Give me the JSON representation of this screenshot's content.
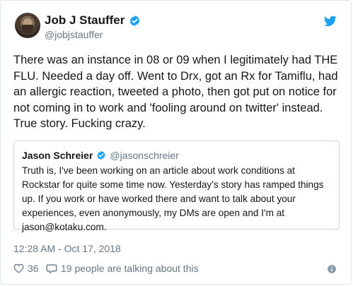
{
  "author": {
    "display_name": "Job J Stauffer",
    "handle": "@jobjstauffer",
    "verified_icon": "verified-badge-icon"
  },
  "tweet": {
    "text": "There was an instance in 08 or 09 when I legitimately had THE FLU. Needed a day off. Went to Drx, got an Rx for Tamiflu, had an allergic reaction, tweeted a photo, then got put on notice for not coming in to work and 'fooling around on twitter' instead. True story. Fucking crazy.",
    "timestamp": "12:28 AM - Oct 17, 2018"
  },
  "quoted_tweet": {
    "display_name": "Jason Schreier",
    "handle": "@jasonschreier",
    "text": "Truth is, I've been working on an article about work conditions at Rockstar for quite some time now. Yesterday's story has ramped things up. If you work or have worked there and want to talk about your experiences, even anonymously, my DMs are open and I'm at jason@kotaku.com."
  },
  "actions": {
    "like_count": "36",
    "talking_label": "19 people are talking about this"
  },
  "colors": {
    "twitter_blue": "#1da1f2",
    "text": "#14171a",
    "muted": "#657786",
    "border": "#e1e8ed"
  }
}
